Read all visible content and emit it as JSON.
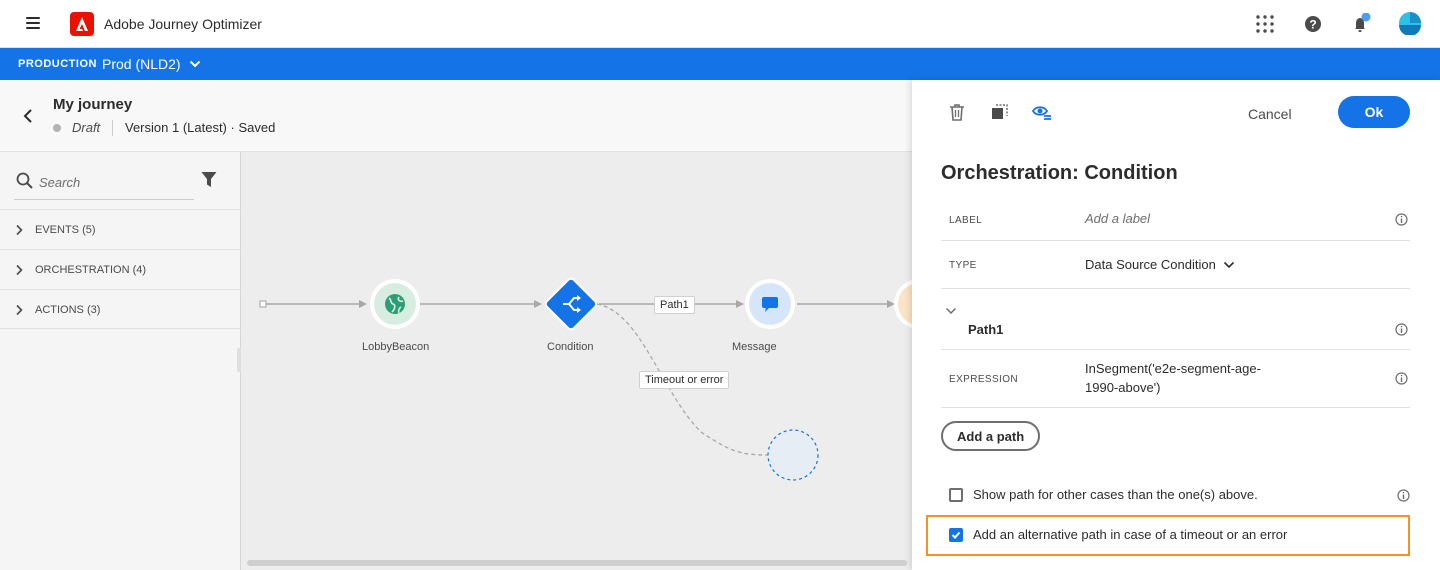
{
  "app": {
    "name": "Adobe Journey Optimizer"
  },
  "env": {
    "label": "PRODUCTION",
    "value": "Prod (NLD2)"
  },
  "journey": {
    "title": "My journey",
    "status": "Draft",
    "version": "Version 1 (Latest) · Saved"
  },
  "palette": {
    "search_placeholder": "Search",
    "categories": [
      {
        "label": "EVENTS (5)"
      },
      {
        "label": "ORCHESTRATION (4)"
      },
      {
        "label": "ACTIONS (3)"
      }
    ]
  },
  "canvas": {
    "nodes": [
      {
        "label": "LobbyBeacon",
        "icon": "globe-icon"
      },
      {
        "label": "Condition",
        "icon": "condition-icon"
      },
      {
        "label": "Message",
        "icon": "chat-icon"
      }
    ],
    "path_chip": "Path1",
    "timeout_chip": "Timeout or error"
  },
  "panel": {
    "cancel_label": "Cancel",
    "ok_label": "Ok",
    "title": "Orchestration: Condition",
    "label_key": "LABEL",
    "label_placeholder": "Add a label",
    "type_key": "TYPE",
    "type_value": "Data Source Condition",
    "path_name": "Path1",
    "expression_key": "EXPRESSION",
    "expression_line1": "InSegment('e2e-segment-age-",
    "expression_line2": "1990-above')",
    "add_path_label": "Add a path",
    "show_other_label": "Show path for other cases than the one(s) above.",
    "show_other_checked": false,
    "alt_path_label": "Add an alternative path in case of a timeout or an error",
    "alt_path_checked": true
  },
  "colors": {
    "accent": "#1473e6",
    "highlight": "#f29423",
    "brand": "#eb1000"
  }
}
